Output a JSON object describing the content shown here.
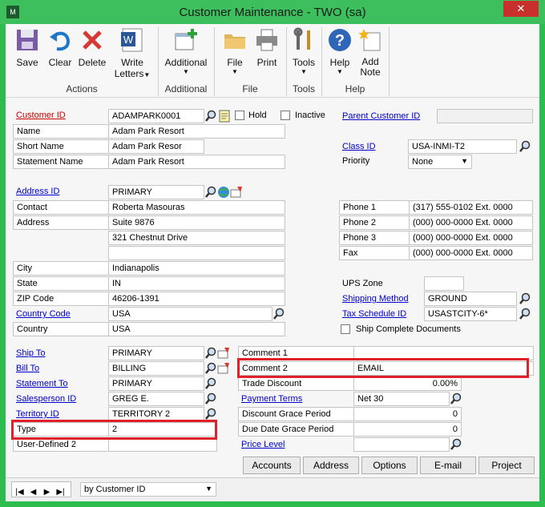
{
  "window": {
    "title": "Customer Maintenance  -  TWO (sa)",
    "app_icon": "M",
    "close": "✕"
  },
  "ribbon": {
    "save": "Save",
    "clear": "Clear",
    "delete": "Delete",
    "write_letters": "Write Letters",
    "additional": "Additional",
    "file": "File",
    "print": "Print",
    "tools": "Tools",
    "help": "Help",
    "add_note": "Add Note",
    "groups": {
      "actions": "Actions",
      "additional": "Additional",
      "file": "File",
      "tools": "Tools",
      "help": "Help"
    }
  },
  "labels": {
    "customer_id": "Customer ID",
    "name": "Name",
    "short_name": "Short Name",
    "statement_name": "Statement Name",
    "hold": "Hold",
    "inactive": "Inactive",
    "parent_customer_id": "Parent Customer ID",
    "class_id": "Class ID",
    "priority": "Priority",
    "address_id": "Address ID",
    "contact": "Contact",
    "address": "Address",
    "city": "City",
    "state": "State",
    "zip_code": "ZIP Code",
    "country_code": "Country Code",
    "country": "Country",
    "phone1": "Phone 1",
    "phone2": "Phone 2",
    "phone3": "Phone 3",
    "fax": "Fax",
    "ups_zone": "UPS Zone",
    "shipping_method": "Shipping Method",
    "tax_schedule_id": "Tax Schedule ID",
    "ship_complete": "Ship Complete Documents",
    "ship_to": "Ship To",
    "bill_to": "Bill To",
    "statement_to": "Statement To",
    "salesperson_id": "Salesperson ID",
    "territory_id": "Territory ID",
    "type": "Type",
    "user_defined2": "User-Defined 2",
    "comment1": "Comment 1",
    "comment2": "Comment 2",
    "trade_discount": "Trade Discount",
    "payment_terms": "Payment Terms",
    "discount_grace": "Discount Grace Period",
    "due_date_grace": "Due Date Grace Period",
    "price_level": "Price Level"
  },
  "values": {
    "customer_id": "ADAMPARK0001",
    "name": "Adam Park Resort",
    "short_name": "Adam Park Resor",
    "statement_name": "Adam Park Resort",
    "parent_customer_id": "",
    "class_id": "USA-INMI-T2",
    "priority": "None",
    "address_id": "PRIMARY",
    "contact": "Roberta Masouras",
    "address1": "Suite 9876",
    "address2": "321 Chestnut Drive",
    "address3": "",
    "city": "Indianapolis",
    "state": "IN",
    "zip_code": "46206-1391",
    "country_code": "USA",
    "country": "USA",
    "phone1": "(317) 555-0102  Ext. 0000",
    "phone2": "(000) 000-0000  Ext. 0000",
    "phone3": "(000) 000-0000  Ext. 0000",
    "fax": "(000) 000-0000  Ext. 0000",
    "ups_zone": "",
    "shipping_method": "GROUND",
    "tax_schedule_id": "USASTCITY-6*",
    "ship_to": "PRIMARY",
    "bill_to": "BILLING",
    "statement_to": "PRIMARY",
    "salesperson_id": "GREG E.",
    "territory_id": "TERRITORY 2",
    "type": "2",
    "user_defined2": "",
    "comment1": "",
    "comment2": "EMAIL",
    "trade_discount": "0.00%",
    "payment_terms": "Net 30",
    "discount_grace": "0",
    "due_date_grace": "0",
    "price_level": ""
  },
  "buttons": {
    "accounts": "Accounts",
    "address": "Address",
    "options": "Options",
    "email": "E-mail",
    "project": "Project"
  },
  "status": {
    "sort_by": "by Customer ID"
  },
  "colors": {
    "titlebar": "#3cbf5c",
    "highlight": "#e0202a",
    "link": "#0000cc",
    "required": "#cc0000"
  }
}
